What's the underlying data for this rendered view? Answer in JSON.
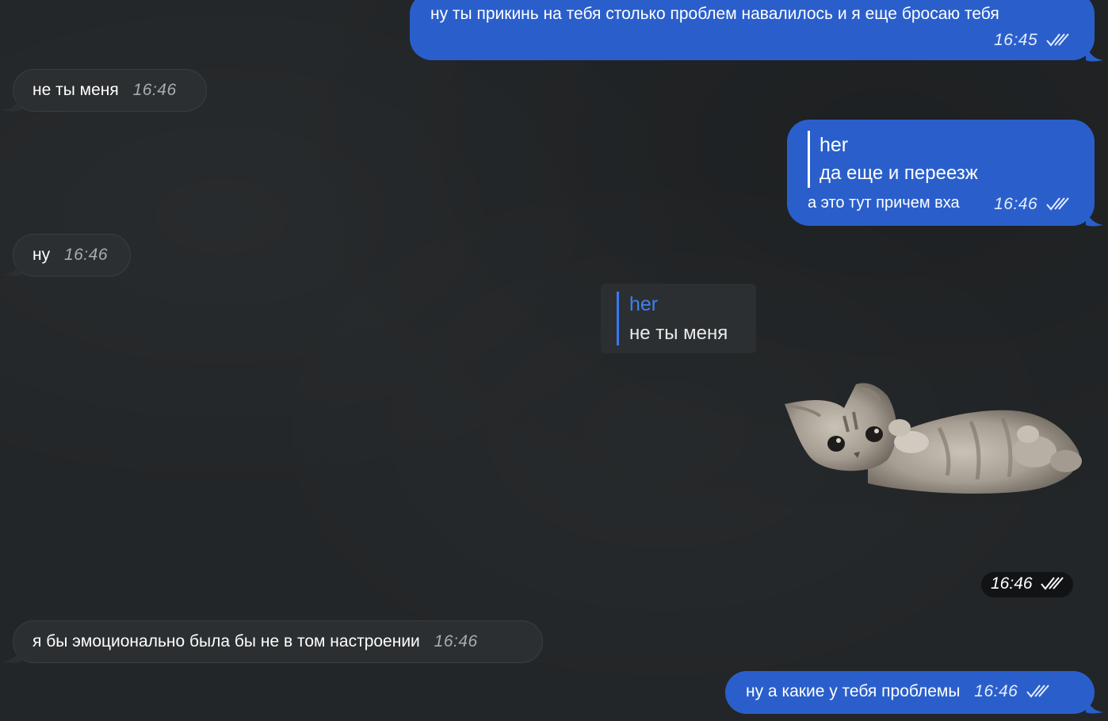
{
  "chat": {
    "messages": [
      {
        "dir": "out",
        "text": "ну ты прикинь на тебя столько проблем навалилось и я еще бросаю тебя",
        "time": "16:45",
        "status": "read-double-check"
      },
      {
        "dir": "in",
        "text": "не ты меня",
        "time": "16:46"
      },
      {
        "dir": "out",
        "reply_author": "her",
        "reply_text": "да еще и переезж",
        "text": "а это тут причем вха",
        "time": "16:46",
        "status": "read-double-check"
      },
      {
        "dir": "in",
        "text": "ну",
        "time": "16:46"
      },
      {
        "dir": "in",
        "type": "reply-preview",
        "reply_author": "her",
        "reply_text": "не ты меня"
      },
      {
        "dir": "out",
        "type": "sticker",
        "sticker": "kitten-lying-on-back",
        "time": "16:46",
        "status": "read-double-check"
      },
      {
        "dir": "in",
        "text": "я бы эмоционально была бы не в том настроении",
        "time": "16:46"
      },
      {
        "dir": "out",
        "text": "ну а какие у тебя проблемы",
        "time": "16:46",
        "status": "read-double-check"
      }
    ]
  },
  "icons": {
    "read_status": "double-check-icon",
    "sticker": "kitten-sticker"
  },
  "colors": {
    "outgoing_bubble": "#2a5fcb",
    "incoming_bubble": "#2c2f31",
    "background": "#232628",
    "reply_accent": "#3b80f5"
  }
}
